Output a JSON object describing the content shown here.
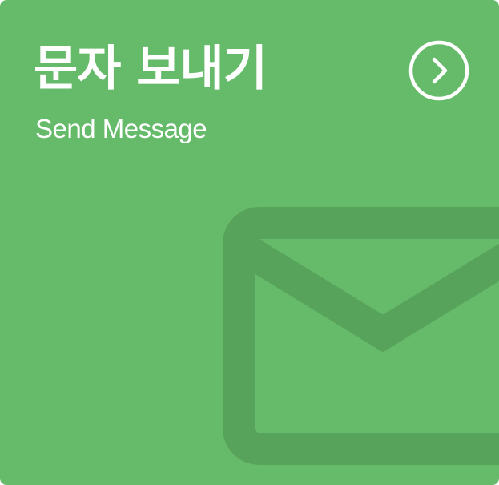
{
  "card": {
    "title": "문자 보내기",
    "subtitle": "Send Message",
    "background_color": "#66bb6a",
    "foreground_color": "#ffffff",
    "watermark_color": "#57a35b",
    "action_icon": "chevron-right-circle-icon",
    "watermark_icon": "envelope-icon"
  }
}
